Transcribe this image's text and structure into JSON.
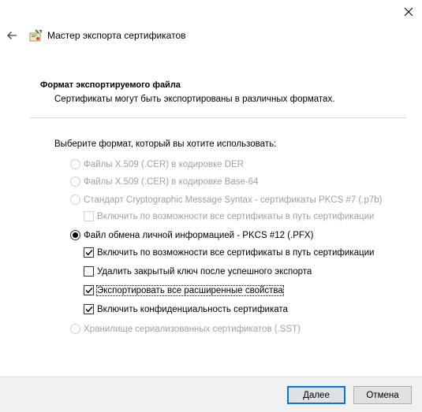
{
  "window": {
    "title": "Мастер экспорта сертификатов"
  },
  "header": {
    "section_title": "Формат экспортируемого файла",
    "section_description": "Сертификаты могут быть экспортированы в различных форматах."
  },
  "form": {
    "prompt": "Выберите формат, который вы хотите использовать:",
    "options": [
      {
        "label": "Файлы X.509 (.CER) в кодировке DER",
        "selected": false,
        "enabled": false
      },
      {
        "label": "Файлы X.509 (.CER) в кодировке Base-64",
        "selected": false,
        "enabled": false
      },
      {
        "label": "Стандарт Cryptographic Message Syntax - сертификаты PKCS #7 (.p7b)",
        "selected": false,
        "enabled": false
      },
      {
        "label": "Файл обмена личной информацией - PKCS #12 (.PFX)",
        "selected": true,
        "enabled": true
      },
      {
        "label": "Хранилище сериализованных сертификатов (.SST)",
        "selected": false,
        "enabled": false
      }
    ],
    "pkcs7_include_all": {
      "label": "Включить по возможности все сертификаты в путь сертификации",
      "checked": false,
      "enabled": false
    },
    "pkcs12_options": [
      {
        "label": "Включить по возможности все сертификаты в путь сертификации",
        "checked": true
      },
      {
        "label": "Удалить закрытый ключ после успешного экспорта",
        "checked": false
      },
      {
        "label": "Экспортировать все расширенные свойства",
        "checked": true
      },
      {
        "label": "Включить конфиденциальность сертификата",
        "checked": true
      }
    ]
  },
  "buttons": {
    "next": "Далее",
    "cancel": "Отмена"
  },
  "icons": {
    "close": "close-icon",
    "back": "back-arrow-icon",
    "wizard": "certificate-wizard-icon"
  }
}
